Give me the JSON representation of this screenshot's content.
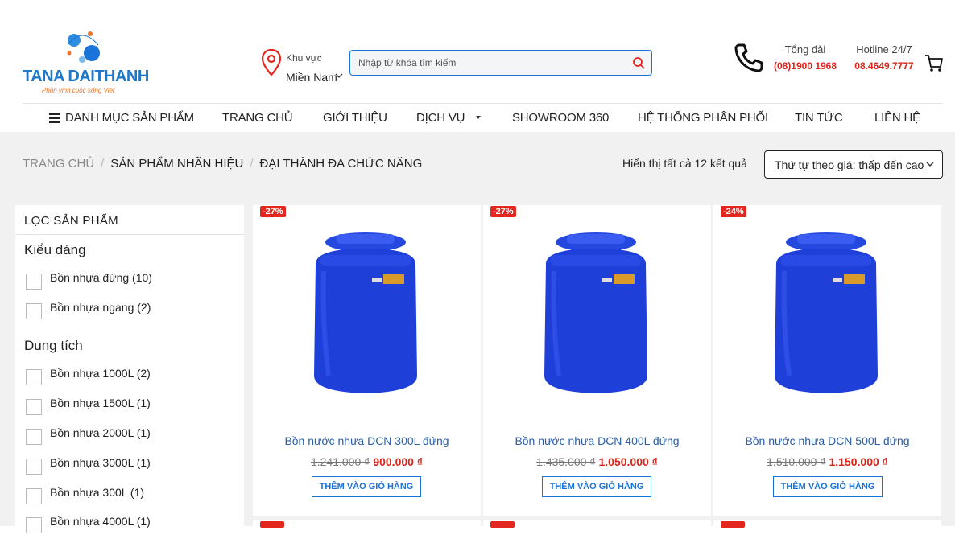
{
  "logo": {
    "name": "TANA DAITHANH",
    "tagline": "Phồn vinh cuộc sống Việt"
  },
  "region": {
    "label": "Khu vực",
    "value": "Miền Nam"
  },
  "search": {
    "placeholder": "Nhập từ khóa tìm kiếm"
  },
  "contact": {
    "hotline1_title": "Tổng đài",
    "hotline1_number": "(08)1900 1968",
    "hotline2_title": "Hotline 24/7",
    "hotline2_number": "08.4649.7777"
  },
  "nav": [
    {
      "label": "DANH MỤC SẢN PHẨM"
    },
    {
      "label": "TRANG CHỦ"
    },
    {
      "label": "GIỚI THIỆU"
    },
    {
      "label": "DỊCH VỤ"
    },
    {
      "label": "SHOWROOM 360"
    },
    {
      "label": "HỆ THỐNG PHÂN PHỐI"
    },
    {
      "label": "TIN TỨC"
    },
    {
      "label": "LIÊN HỆ"
    }
  ],
  "breadcrumb": [
    "TRANG CHỦ",
    "SẢN PHẨM NHÃN HIỆU",
    "ĐẠI THÀNH ĐA CHỨC NĂNG"
  ],
  "result_count": "Hiển thị tất cả 12 kết quả",
  "sort": {
    "value": "Thứ tự theo giá: thấp đến cao"
  },
  "filter": {
    "title": "LỌC SẢN PHẨM",
    "groups": [
      {
        "title": "Kiểu dáng",
        "options": [
          "Bồn nhựa đứng (10)",
          "Bồn nhựa ngang (2)"
        ]
      },
      {
        "title": "Dung tích",
        "options": [
          "Bồn nhựa 1000L (2)",
          "Bồn nhựa 1500L (1)",
          "Bồn nhựa 2000L (1)",
          "Bồn nhựa 3000L (1)",
          "Bồn nhựa 300L (1)",
          "Bồn nhựa 4000L (1)"
        ]
      }
    ]
  },
  "products": [
    {
      "badge": "-27%",
      "name": "Bồn nước nhựa DCN 300L đứng",
      "old_price": "1.241.000 ₫",
      "new_price": "900.000 ₫",
      "button": "THÊM VÀO GIỎ HÀNG"
    },
    {
      "badge": "-27%",
      "name": "Bồn nước nhựa DCN 400L đứng",
      "old_price": "1.435.000 ₫",
      "new_price": "1.050.000 ₫",
      "button": "THÊM VÀO GIỎ HÀNG"
    },
    {
      "badge": "-24%",
      "name": "Bồn nước nhựa DCN 500L đứng",
      "old_price": "1.510.000 ₫",
      "new_price": "1.150.000 ₫",
      "button": "THÊM VÀO GIỎ HÀNG"
    }
  ],
  "colors": {
    "accent": "#1a73d9",
    "price_red": "#d9251c",
    "tank_blue": "#1a3fd6",
    "background": "#f1f1f1"
  }
}
